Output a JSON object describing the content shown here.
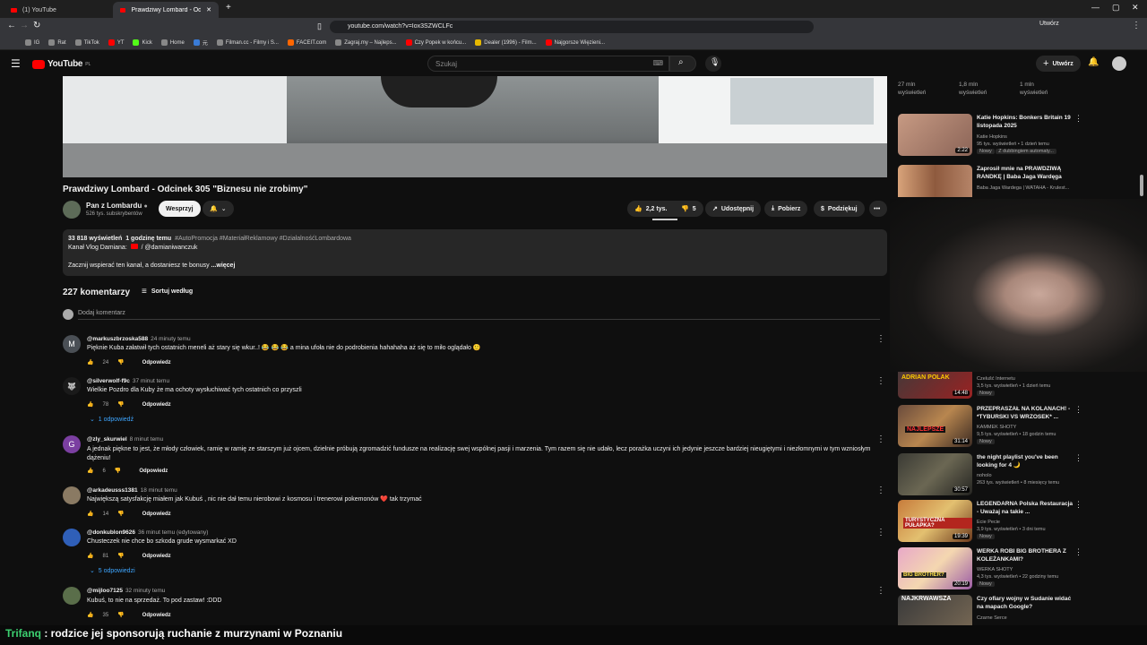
{
  "browser": {
    "tabs": [
      {
        "label": "(1) YouTube"
      },
      {
        "label": "Prawdziwy Lombard - Odcinek 3"
      }
    ],
    "url": "youtube.com/watch?v=Iox3SZWCLFc",
    "bookmarks": [
      "IG",
      "Rat",
      "TikTok",
      "YT",
      "Kick",
      "Home",
      "元",
      "Filman.cc - Filmy i S...",
      "FACEIT.com",
      "Zagraj.my – Najleps...",
      "Czy Popek w końcu...",
      "Dealer (1996) - Film...",
      "Najgorsze Więzieni..."
    ]
  },
  "yt": {
    "logo": "YouTube",
    "region": "PL",
    "search_placeholder": "Szukaj",
    "create_label": "Utwórz"
  },
  "video": {
    "title": "Prawdziwy Lombard - Odcinek 305 \"Biznesu nie zrobimy\"",
    "channel": "Pan z Lombardu",
    "subscribers": "526 tys. subskrybentów",
    "join_label": "Wesprzyj",
    "likes": "2,2 tys.",
    "dislikes": "5",
    "share_label": "Udostępnij",
    "download_label": "Pobierz",
    "thanks_label": "Podziękuj",
    "views": "33 818 wyświetleń",
    "age": "1 godzinę temu",
    "hashtags": "#AutoPromocja #MateriałReklamowy #DziałalnośćLombardowa",
    "desc_line1": "Kanał Vlog Damiana:",
    "desc_link": "/ @damianiwanczuk",
    "desc_line2": "Zacznij wspierać ten kanał, a dostaniesz te bonusy",
    "more_label": "...więcej"
  },
  "comments_header": {
    "count": "227 komentarzy",
    "sort_label": "Sortuj według",
    "add_placeholder": "Dodaj komentarz"
  },
  "comments": [
    {
      "user": "@markuszbrzoska588",
      "time": "24 minuty temu",
      "initial": "M",
      "text": "Pięknie Kuba załatwił tych ostatnich meneli aż stary się wkur..! 😂 😂 😂  a mina ufoła nie do podrobienia hahahaha aż się to miło oglądało 🙂",
      "likes": "24",
      "reply": "Odpowiedz"
    },
    {
      "user": "@silverwolf-f9c",
      "time": "37 minut temu",
      "initial": "",
      "text": "Wielkie Pozdro dla Kuby że ma ochoty wysłuchiwać tych ostatnich co przyszli",
      "likes": "78",
      "reply": "Odpowiedz",
      "replies": "1 odpowiedź"
    },
    {
      "user": "@zly_skurwiel",
      "time": "8 minut temu",
      "initial": "G",
      "text": "A jednak piękne to jest, że młody człowiek, ramię w ramię ze starszym już ojcem, dzielnie próbują zgromadzić fundusze na realizację swej wspólnej pasji i marzenia. Tym razem się nie udało, lecz porażka uczyni ich jedynie jeszcze bardziej nieugiętymi i niezłomnymi w tym wzniosłym dążeniu!",
      "likes": "6",
      "reply": "Odpowiedz"
    },
    {
      "user": "@arkadeusss1381",
      "time": "18 minut temu",
      "initial": "",
      "text": "Największą satysfakcję miałem jak Kubuś , nic nie dał temu nierobowi z kosmosu i trenerowi pokemonów ❤️ tak trzymać",
      "likes": "14",
      "reply": "Odpowiedz"
    },
    {
      "user": "@donkublon9626",
      "time": "36 minut temu (edytowany)",
      "initial": "",
      "text": "Chusteczek nie chce bo szkoda grude wysmarkać XD",
      "likes": "81",
      "reply": "Odpowiedz",
      "replies": "5 odpowiedzi"
    },
    {
      "user": "@mijloo7125",
      "time": "32 minuty temu",
      "initial": "",
      "text": "Kubuś, to nie na sprzedaż. To pod zastaw! :DDD",
      "likes": "35",
      "reply": "Odpowiedz"
    }
  ],
  "sidebar": {
    "top_stats": [
      {
        "views": "27 mln",
        "label": "wyświetleń"
      },
      {
        "views": "1,8 mln",
        "label": "wyświetleń"
      },
      {
        "views": "1 mln",
        "label": "wyświetleń"
      }
    ],
    "recs": [
      {
        "title": "Katie Hopkins: Bonkers Britain 19 listopada 2025",
        "channel": "Katie Hopkins",
        "meta": "95 tys. wyświetleń • 1 dzień temu",
        "badge": "Nowy",
        "extra": "Z dubbingiem automaty...",
        "dur": "2:22"
      },
      {
        "title": "Zaprosił mnie na PRAWDZIWĄ RANDKĘ | Baba Jaga Wardęga",
        "channel": "Baba Jaga Wardega | WATAHA - Krulest...",
        "meta": "",
        "badge": "",
        "extra": "",
        "dur": ""
      },
      {
        "title": "",
        "channel": "Czelušć Internetu",
        "meta": "3,5 tys. wyświetleń • 1 dzień temu",
        "badge": "Nowy",
        "extra": "",
        "dur": "14:48",
        "thumb_text": "ADRIAN POLAK"
      },
      {
        "title": "PRZEPRASZAŁ NA KOLANACH! - *TYBURSKI VS WRZOSEK* ...",
        "channel": "KAMMEK SHOTY",
        "meta": "9,5 tys. wyświetleń • 18 godzin temu",
        "badge": "Nowy",
        "extra": "",
        "dur": "31:14",
        "thumb_text": "NAJLEPSZE"
      },
      {
        "title": "the night playlist you've been looking for 4 🌙",
        "channel": "noholo",
        "meta": "263 tys. wyświetleń • 8 miesięcy temu",
        "badge": "",
        "extra": "",
        "dur": "30:57"
      },
      {
        "title": "LEGENDARNA Polska Restauracja - Uważaj na takie ...",
        "channel": "Ecie Pecie",
        "meta": "3,9 tys. wyświetleń • 3 dni temu",
        "badge": "Nowy",
        "extra": "",
        "dur": "19:39",
        "thumb_text": "TURYSTYCZNA PUŁAPKA?"
      },
      {
        "title": "WERKA ROBI BIG BROTHERA Z KOLEŻANKAMI?",
        "channel": "WERKA SHOTY",
        "meta": "4,3 tys. wyświetleń • 22 godziny temu",
        "badge": "Nowy",
        "extra": "",
        "dur": "20:19",
        "thumb_text": "BIG BROTHER?"
      },
      {
        "title": "Czy ofiary wojny w Sudanie widać na mapach Google?",
        "channel": "Czarne Serce",
        "meta": "",
        "badge": "",
        "extra": "",
        "dur": "",
        "thumb_text": "NAJKRWAWSZA"
      }
    ]
  },
  "chat_ticker": {
    "user": "Trifanq",
    "message": " : rodzice jej sponsorują ruchanie z murzynami w Poznaniu"
  },
  "colors": {
    "bg": "#0f0f0f",
    "link": "#3ea6ff",
    "chip": "#272727",
    "accent_red": "#ff0000",
    "ticker_user": "#3cd070"
  }
}
